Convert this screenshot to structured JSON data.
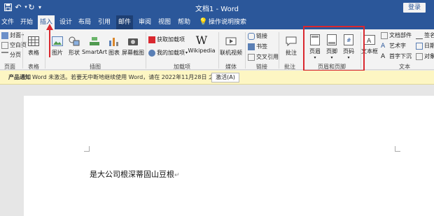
{
  "window": {
    "title": "文档1 - Word",
    "login_label": "登录"
  },
  "quick_access": {
    "save_icon": "save-icon",
    "undo_icon": "undo-icon",
    "redo_icon": "redo-icon",
    "customize_icon": "dropdown-icon"
  },
  "tabs": [
    "文件",
    "开始",
    "插入",
    "设计",
    "布局",
    "引用",
    "邮件",
    "审阅",
    "视图",
    "帮助",
    "操作说明搜索"
  ],
  "ribbon": {
    "pages": {
      "cover": "封面",
      "blank": "空白页",
      "break": "分页",
      "group": "页面"
    },
    "tables": {
      "table": "表格",
      "group": "表格"
    },
    "illustrations": {
      "pictures": "图片",
      "shapes": "形状",
      "smartart": "SmartArt",
      "chart": "图表",
      "screenshot": "屏幕截图",
      "group": "插图"
    },
    "addins": {
      "get": "获取加载项",
      "mine": "我的加载项",
      "wikipedia": "Wikipedia",
      "group": "加载项"
    },
    "media": {
      "video": "联机视频",
      "group": "媒体"
    },
    "links": {
      "link": "链接",
      "bookmark": "书签",
      "cross_ref": "交叉引用",
      "group": "链接"
    },
    "comments": {
      "comment": "批注",
      "group": "批注"
    },
    "header_footer": {
      "header": "页眉",
      "footer": "页脚",
      "page_number": "页码",
      "group": "页眉和页脚"
    },
    "text": {
      "textbox": "文本框",
      "quickparts": "文档部件",
      "wordart": "艺术字",
      "dropcap": "首字下沉",
      "signature": "签名行",
      "datetime": "日期和",
      "object": "对象",
      "group": "文本"
    }
  },
  "notice": {
    "label": "产品通知",
    "message": "Word 未激活。若要无中断地继续使用 Word，请在 2022年11月28日 之前激活。",
    "button": "激活(A)"
  },
  "document": {
    "text": "是大公司根深蒂固山豆根",
    "para_mark": "↵"
  },
  "colors": {
    "brand": "#2b579a",
    "highlight": "#d9282f"
  }
}
